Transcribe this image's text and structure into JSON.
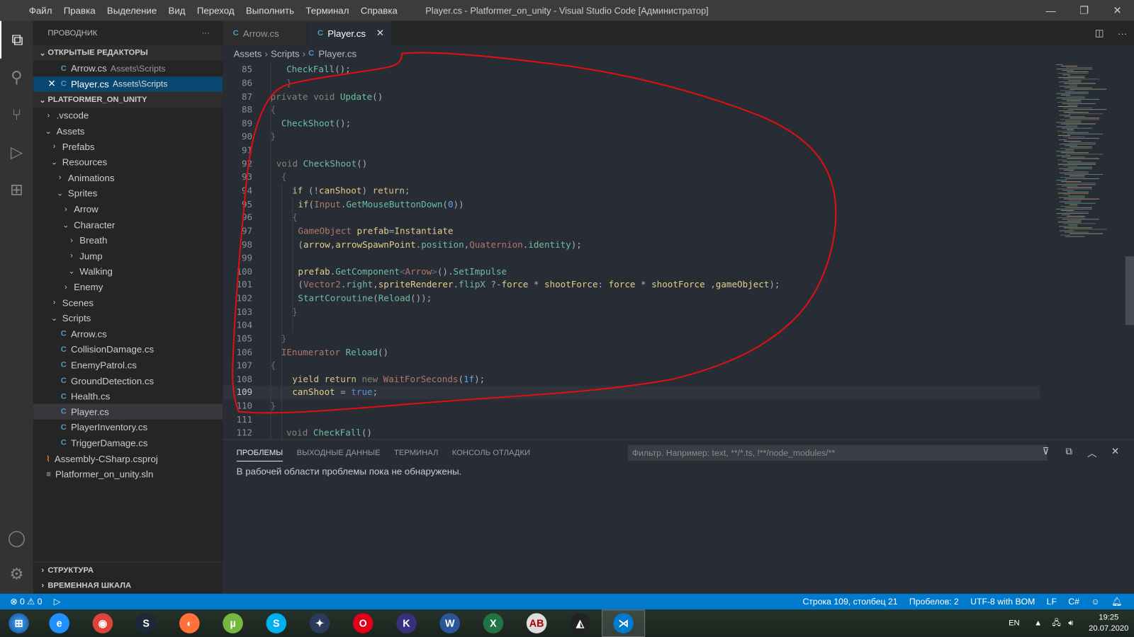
{
  "window": {
    "title": "Player.cs - Platformer_on_unity - Visual Studio Code [Администратор]",
    "menu": [
      "Файл",
      "Правка",
      "Выделение",
      "Вид",
      "Переход",
      "Выполнить",
      "Терминал",
      "Справка"
    ]
  },
  "explorer": {
    "title": "ПРОВОДНИК",
    "more": "···",
    "open_editors_label": "ОТКРЫТЫЕ РЕДАКТОРЫ",
    "open_editors": [
      {
        "name": "Arrow.cs",
        "path": "Assets\\Scripts"
      },
      {
        "name": "Player.cs",
        "path": "Assets\\Scripts"
      }
    ],
    "project_label": "PLATFORMER_ON_UNITY",
    "tree": [
      {
        "label": ".vscode",
        "depth": 1,
        "kind": "folder",
        "open": false
      },
      {
        "label": "Assets",
        "depth": 1,
        "kind": "folder",
        "open": true
      },
      {
        "label": "Prefabs",
        "depth": 2,
        "kind": "folder",
        "open": false
      },
      {
        "label": "Resources",
        "depth": 2,
        "kind": "folder",
        "open": true
      },
      {
        "label": "Animations",
        "depth": 3,
        "kind": "folder",
        "open": false
      },
      {
        "label": "Sprites",
        "depth": 3,
        "kind": "folder",
        "open": true
      },
      {
        "label": "Arrow",
        "depth": 4,
        "kind": "folder",
        "open": false
      },
      {
        "label": "Character",
        "depth": 4,
        "kind": "folder",
        "open": true
      },
      {
        "label": "Breath",
        "depth": 5,
        "kind": "folder",
        "open": false
      },
      {
        "label": "Jump",
        "depth": 5,
        "kind": "folder",
        "open": false
      },
      {
        "label": "Walking",
        "depth": 5,
        "kind": "folder",
        "open": true
      },
      {
        "label": "Enemy",
        "depth": 4,
        "kind": "folder",
        "open": false
      },
      {
        "label": "Scenes",
        "depth": 2,
        "kind": "folder",
        "open": false
      },
      {
        "label": "Scripts",
        "depth": 2,
        "kind": "folder",
        "open": true
      },
      {
        "label": "Arrow.cs",
        "depth": 3,
        "kind": "cs"
      },
      {
        "label": "CollisionDamage.cs",
        "depth": 3,
        "kind": "cs"
      },
      {
        "label": "EnemyPatrol.cs",
        "depth": 3,
        "kind": "cs"
      },
      {
        "label": "GroundDetection.cs",
        "depth": 3,
        "kind": "cs"
      },
      {
        "label": "Health.cs",
        "depth": 3,
        "kind": "cs"
      },
      {
        "label": "Player.cs",
        "depth": 3,
        "kind": "cs",
        "selected": true
      },
      {
        "label": "PlayerInventory.cs",
        "depth": 3,
        "kind": "cs"
      },
      {
        "label": "TriggerDamage.cs",
        "depth": 3,
        "kind": "cs"
      },
      {
        "label": "Assembly-CSharp.csproj",
        "depth": 1,
        "kind": "rss"
      },
      {
        "label": "Platformer_on_unity.sln",
        "depth": 1,
        "kind": "sln"
      }
    ],
    "outline_label": "СТРУКТУРА",
    "timeline_label": "ВРЕМЕННАЯ ШКАЛА"
  },
  "tabs": [
    {
      "label": "Arrow.cs",
      "active": false
    },
    {
      "label": "Player.cs",
      "active": true
    }
  ],
  "breadcrumb": [
    "Assets",
    "Scripts",
    "Player.cs"
  ],
  "editor": {
    "current_line": 109,
    "lines": [
      {
        "n": "85",
        "i": 88,
        "t": [
          [
            "CheckFall",
            "fn"
          ],
          [
            "();",
            "p"
          ]
        ]
      },
      {
        "n": "86",
        "i": 88,
        "t": [
          [
            "}",
            "br"
          ]
        ]
      },
      {
        "n": "87",
        "i": 66,
        "t": [
          [
            "private ",
            "mut"
          ],
          [
            "void ",
            "mut"
          ],
          [
            "Update",
            "fn"
          ],
          [
            "()",
            "p"
          ]
        ]
      },
      {
        "n": "88",
        "i": 66,
        "t": [
          [
            "{",
            "br"
          ]
        ]
      },
      {
        "n": "89",
        "i": 81,
        "t": [
          [
            "CheckShoot",
            "fn"
          ],
          [
            "();",
            "p"
          ]
        ]
      },
      {
        "n": "90",
        "i": 66,
        "t": [
          [
            "}",
            "br"
          ]
        ]
      },
      {
        "n": "91",
        "i": 66,
        "t": []
      },
      {
        "n": "92",
        "i": 74,
        "t": [
          [
            "void ",
            "mut"
          ],
          [
            "CheckShoot",
            "fn"
          ],
          [
            "()",
            "p"
          ]
        ]
      },
      {
        "n": "93",
        "i": 81,
        "t": [
          [
            "{",
            "br"
          ]
        ]
      },
      {
        "n": "94",
        "i": 96,
        "t": [
          [
            "if ",
            "kw"
          ],
          [
            "(!",
            "p"
          ],
          [
            "canShoot",
            "id"
          ],
          [
            ") ",
            "p"
          ],
          [
            "return",
            "kw"
          ],
          [
            ";",
            "p"
          ]
        ]
      },
      {
        "n": "95",
        "i": 104,
        "t": [
          [
            "if",
            "kw"
          ],
          [
            "(",
            "p"
          ],
          [
            "Input",
            "ty"
          ],
          [
            ".",
            "p"
          ],
          [
            "GetMouseButtonDown",
            "fn"
          ],
          [
            "(",
            "p"
          ],
          [
            "0",
            "num"
          ],
          [
            "))",
            "p"
          ]
        ]
      },
      {
        "n": "96",
        "i": 96,
        "t": [
          [
            "{",
            "br"
          ]
        ]
      },
      {
        "n": "97",
        "i": 104,
        "t": [
          [
            "GameObject ",
            "ty"
          ],
          [
            "prefab",
            "id"
          ],
          [
            "=",
            "p"
          ],
          [
            "Instantiate",
            "id"
          ]
        ]
      },
      {
        "n": "98",
        "i": 104,
        "t": [
          [
            "(",
            "p"
          ],
          [
            "arrow",
            "id"
          ],
          [
            ",",
            "p"
          ],
          [
            "arrowSpawnPoint",
            "id"
          ],
          [
            ".",
            "p"
          ],
          [
            "position",
            "fn"
          ],
          [
            ",",
            "p"
          ],
          [
            "Quaternion",
            "ty"
          ],
          [
            ".",
            "p"
          ],
          [
            "identity",
            "fn"
          ],
          [
            ");",
            "p"
          ]
        ]
      },
      {
        "n": "99",
        "i": 104,
        "t": []
      },
      {
        "n": "100",
        "i": 104,
        "t": [
          [
            "prefab",
            "id"
          ],
          [
            ".",
            "p"
          ],
          [
            "GetComponent",
            "fn"
          ],
          [
            "<",
            "br"
          ],
          [
            "Arrow",
            "ty"
          ],
          [
            ">",
            "br"
          ],
          [
            "().",
            "p"
          ],
          [
            "SetImpulse",
            "fn"
          ]
        ]
      },
      {
        "n": "101",
        "i": 104,
        "t": [
          [
            "(",
            "p"
          ],
          [
            "Vector2",
            "ty"
          ],
          [
            ".",
            "p"
          ],
          [
            "right",
            "fn"
          ],
          [
            ",",
            "p"
          ],
          [
            "spriteRenderer",
            "id"
          ],
          [
            ".",
            "p"
          ],
          [
            "flipX",
            "fn"
          ],
          [
            " ?-",
            "p"
          ],
          [
            "force",
            "id"
          ],
          [
            " * ",
            "p"
          ],
          [
            "shootForce",
            "id"
          ],
          [
            ": ",
            "p"
          ],
          [
            "force",
            "id"
          ],
          [
            " * ",
            "p"
          ],
          [
            "shootForce",
            "id"
          ],
          [
            " ,",
            "p"
          ],
          [
            "gameObject",
            "id"
          ],
          [
            ");",
            "p"
          ]
        ]
      },
      {
        "n": "102",
        "i": 104,
        "t": [
          [
            "StartCoroutine",
            "fn"
          ],
          [
            "(",
            "p"
          ],
          [
            "Reload",
            "fn"
          ],
          [
            "());",
            "p"
          ]
        ]
      },
      {
        "n": "103",
        "i": 96,
        "t": [
          [
            "}",
            "br"
          ]
        ]
      },
      {
        "n": "104",
        "i": 96,
        "t": []
      },
      {
        "n": "105",
        "i": 81,
        "t": [
          [
            "}",
            "br"
          ]
        ]
      },
      {
        "n": "106",
        "i": 81,
        "t": [
          [
            "IEnumerator ",
            "ty"
          ],
          [
            "Reload",
            "fn"
          ],
          [
            "()",
            "p"
          ]
        ]
      },
      {
        "n": "107",
        "i": 66,
        "t": [
          [
            "{",
            "br"
          ]
        ]
      },
      {
        "n": "108",
        "i": 96,
        "t": [
          [
            "yield ",
            "kw"
          ],
          [
            "return ",
            "kw"
          ],
          [
            "new ",
            "mut"
          ],
          [
            "WaitForSeconds",
            "ty"
          ],
          [
            "(",
            "p"
          ],
          [
            "1f",
            "num"
          ],
          [
            ");",
            "p"
          ]
        ]
      },
      {
        "n": "109",
        "i": 96,
        "t": [
          [
            "canShoot",
            "id"
          ],
          [
            " = ",
            "p"
          ],
          [
            "true",
            "bool"
          ],
          [
            ";",
            "p"
          ]
        ]
      },
      {
        "n": "110",
        "i": 66,
        "t": [
          [
            "}",
            "br"
          ]
        ]
      },
      {
        "n": "111",
        "i": 66,
        "t": []
      },
      {
        "n": "112",
        "i": 88,
        "t": [
          [
            "void ",
            "mut"
          ],
          [
            "CheckFall",
            "fn"
          ],
          [
            "()",
            "p"
          ]
        ]
      }
    ]
  },
  "panel": {
    "tabs": [
      "ПРОБЛЕМЫ",
      "ВЫХОДНЫЕ ДАННЫЕ",
      "ТЕРМИНАЛ",
      "КОНСОЛЬ ОТЛАДКИ"
    ],
    "filter_placeholder": "Фильтр. Например: text, **/*.ts, !**/node_modules/**",
    "message": "В рабочей области проблемы пока не обнаружены."
  },
  "status": {
    "errors": "0",
    "warnings": "0",
    "position": "Строка 109, столбец 21",
    "indent": "Пробелов: 2",
    "encoding": "UTF-8 with BOM",
    "eol": "LF",
    "language": "C#"
  },
  "taskbar": {
    "apps": [
      {
        "name": "internet-explorer",
        "color": "#1e90ff",
        "glyph": "e"
      },
      {
        "name": "chrome",
        "color": "#db4437",
        "glyph": "◉"
      },
      {
        "name": "steam",
        "color": "#1b2838",
        "glyph": "S"
      },
      {
        "name": "firefox",
        "color": "#ff7139",
        "glyph": "◐"
      },
      {
        "name": "utorrent",
        "color": "#76b83f",
        "glyph": "µ"
      },
      {
        "name": "skype",
        "color": "#00aff0",
        "glyph": "S"
      },
      {
        "name": "unity-hub",
        "color": "#2a3a5a",
        "glyph": "✦"
      },
      {
        "name": "opera",
        "color": "#e0001a",
        "glyph": "O"
      },
      {
        "name": "k-app",
        "color": "#3a2f7a",
        "glyph": "K"
      },
      {
        "name": "word",
        "color": "#2b579a",
        "glyph": "W"
      },
      {
        "name": "excel",
        "color": "#217346",
        "glyph": "X"
      },
      {
        "name": "abc-net",
        "color": "#ddd",
        "glyph": "AB"
      },
      {
        "name": "unity",
        "color": "#222",
        "glyph": "◭"
      },
      {
        "name": "vscode",
        "color": "#007acc",
        "glyph": "⋊",
        "active": true
      }
    ],
    "lang": "EN",
    "time": "19:25",
    "date": "20.07.2020"
  }
}
